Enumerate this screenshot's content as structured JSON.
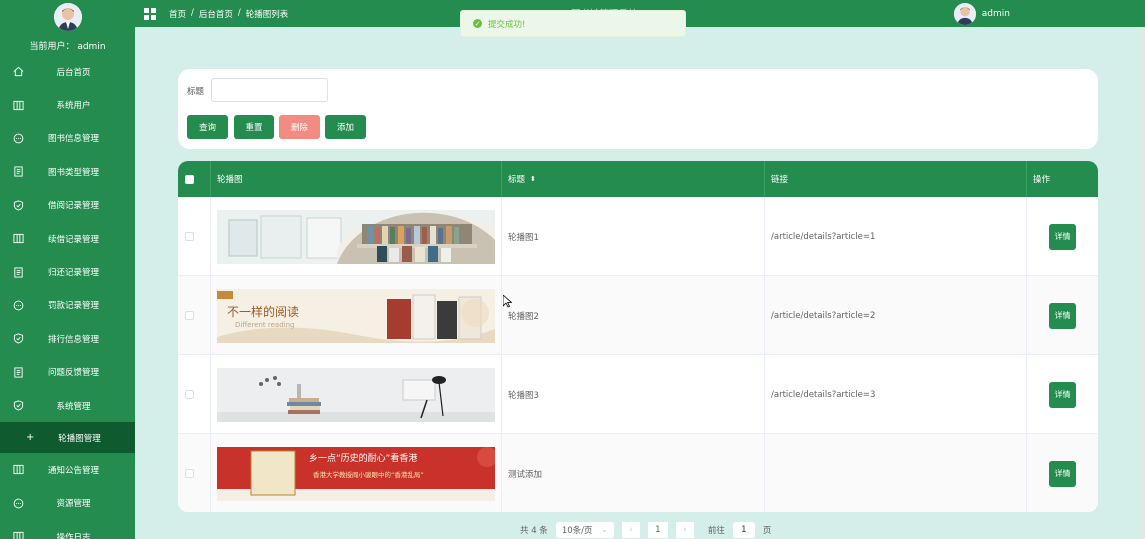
{
  "sidebar": {
    "user_label": "当前用户：  admin",
    "items": [
      {
        "label": "后台首页",
        "icon": "home-icon"
      },
      {
        "label": "系统用户",
        "icon": "columns-icon"
      },
      {
        "label": "图书信息管理",
        "icon": "chat-icon"
      },
      {
        "label": "图书类型管理",
        "icon": "document-icon"
      },
      {
        "label": "借阅记录管理",
        "icon": "shield-icon"
      },
      {
        "label": "续借记录管理",
        "icon": "columns-icon"
      },
      {
        "label": "归还记录管理",
        "icon": "document-icon"
      },
      {
        "label": "罚款记录管理",
        "icon": "chat-icon"
      },
      {
        "label": "排行信息管理",
        "icon": "shield-icon"
      },
      {
        "label": "问题反馈管理",
        "icon": "document-icon"
      },
      {
        "label": "系统管理",
        "icon": "shield-icon"
      },
      {
        "label": "轮播图管理",
        "icon": "plus-icon",
        "active": true
      },
      {
        "label": "通知公告管理",
        "icon": "columns-icon"
      },
      {
        "label": "资源管理",
        "icon": "chat-icon"
      },
      {
        "label": "操作日志",
        "icon": "columns-icon"
      }
    ]
  },
  "topbar": {
    "breadcrumb": [
      "首页",
      "/",
      "后台首页",
      "/",
      "轮播图列表"
    ],
    "system_title": "...图书馆管理系统",
    "username": "admin"
  },
  "toast": {
    "message": "提交成功!",
    "color": "#67c23a"
  },
  "search": {
    "label": "标题",
    "value": "",
    "buttons": {
      "query": "查询",
      "reset": "重置",
      "delete": "删除",
      "add": "添加"
    }
  },
  "table": {
    "headers": {
      "image": "轮播图",
      "title": "标题",
      "sort_icon": "sort-icon",
      "link": "链接",
      "action": "操作"
    },
    "rows": [
      {
        "title": "轮播图1",
        "link": "/article/details?article=1",
        "action": "详情",
        "banner_text": "",
        "banner_sub": ""
      },
      {
        "title": "轮播图2",
        "link": "/article/details?article=2",
        "action": "详情",
        "banner_text": "不一样的阅读",
        "banner_sub": "Different reading"
      },
      {
        "title": "轮播图3",
        "link": "/article/details?article=3",
        "action": "详情",
        "banner_text": "",
        "banner_sub": ""
      },
      {
        "title": "测试添加",
        "link": "",
        "action": "详情",
        "banner_text": "乡一点“历史的耐心”看香港",
        "banner_sub": "香港大学教授阎小骏眼中的“香港乱局”"
      }
    ]
  },
  "pagination": {
    "total": "共 4 条",
    "page_size": "10条/页",
    "current": "1",
    "goto_label": "前往",
    "goto_value": "1",
    "page_suffix": "页"
  },
  "colors": {
    "primary": "#238c4e",
    "danger": "#f28b82",
    "background": "#d4efea"
  }
}
